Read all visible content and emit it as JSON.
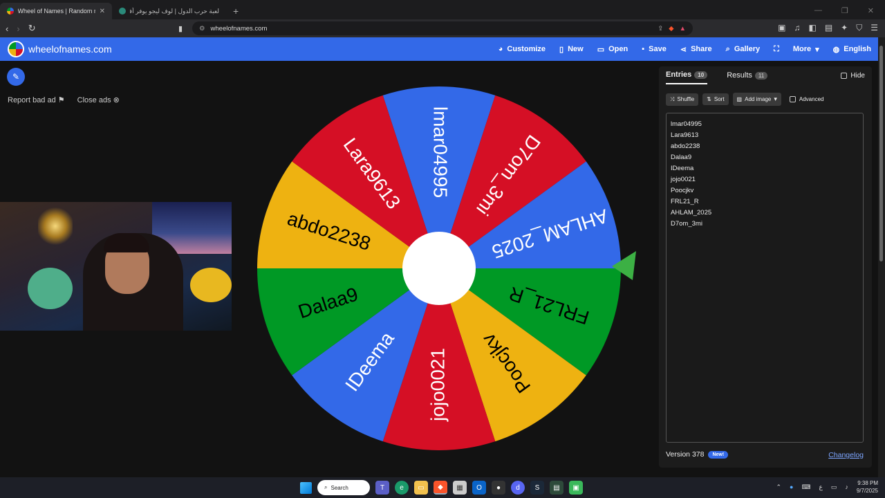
{
  "browser": {
    "tabs": [
      {
        "title": "Wheel of Names | Random name pic"
      },
      {
        "title": "لعبة حرب الدول | لوف ليجو يوفر أفضل"
      }
    ],
    "url": "wheelofnames.com"
  },
  "site": {
    "brand": "wheelofnames.com",
    "nav": {
      "customize": "Customize",
      "new": "New",
      "open": "Open",
      "save": "Save",
      "share": "Share",
      "gallery": "Gallery",
      "more": "More",
      "language": "English"
    },
    "report_bad_ad": "Report bad ad",
    "close_ads": "Close ads"
  },
  "wheel": {
    "segments": [
      {
        "label": "lmar04995",
        "color": "#3369e8"
      },
      {
        "label": "D7om_3mi",
        "color": "#d50f25"
      },
      {
        "label": "AHLAM_2025",
        "color": "#3369e8"
      },
      {
        "label": "FRL21_R",
        "color": "#009925"
      },
      {
        "label": "Poocjkv",
        "color": "#eeb211"
      },
      {
        "label": "jojo0021",
        "color": "#d50f25"
      },
      {
        "label": "IDeema",
        "color": "#3369e8"
      },
      {
        "label": "Dalaa9",
        "color": "#009925"
      },
      {
        "label": "abdo2238",
        "color": "#eeb211"
      },
      {
        "label": "Lara9613",
        "color": "#d50f25"
      }
    ]
  },
  "panel": {
    "tabs": {
      "entries_label": "Entries",
      "entries_count": "10",
      "results_label": "Results",
      "results_count": "11"
    },
    "hide_label": "Hide",
    "tools": {
      "shuffle": "Shuffle",
      "sort": "Sort",
      "add_image": "Add image",
      "advanced": "Advanced"
    },
    "entries": [
      "lmar04995",
      "Lara9613",
      "abdo2238",
      "Dalaa9",
      "IDeema",
      "jojo0021",
      "Poocjkv",
      "FRL21_R",
      "AHLAM_2025",
      "D7om_3mi"
    ],
    "version": "Version 378",
    "new_badge": "New!",
    "changelog": "Changelog"
  },
  "taskbar": {
    "search": "Search",
    "time": "9:38 PM",
    "date": "9/7/2025",
    "lang": "ع"
  }
}
